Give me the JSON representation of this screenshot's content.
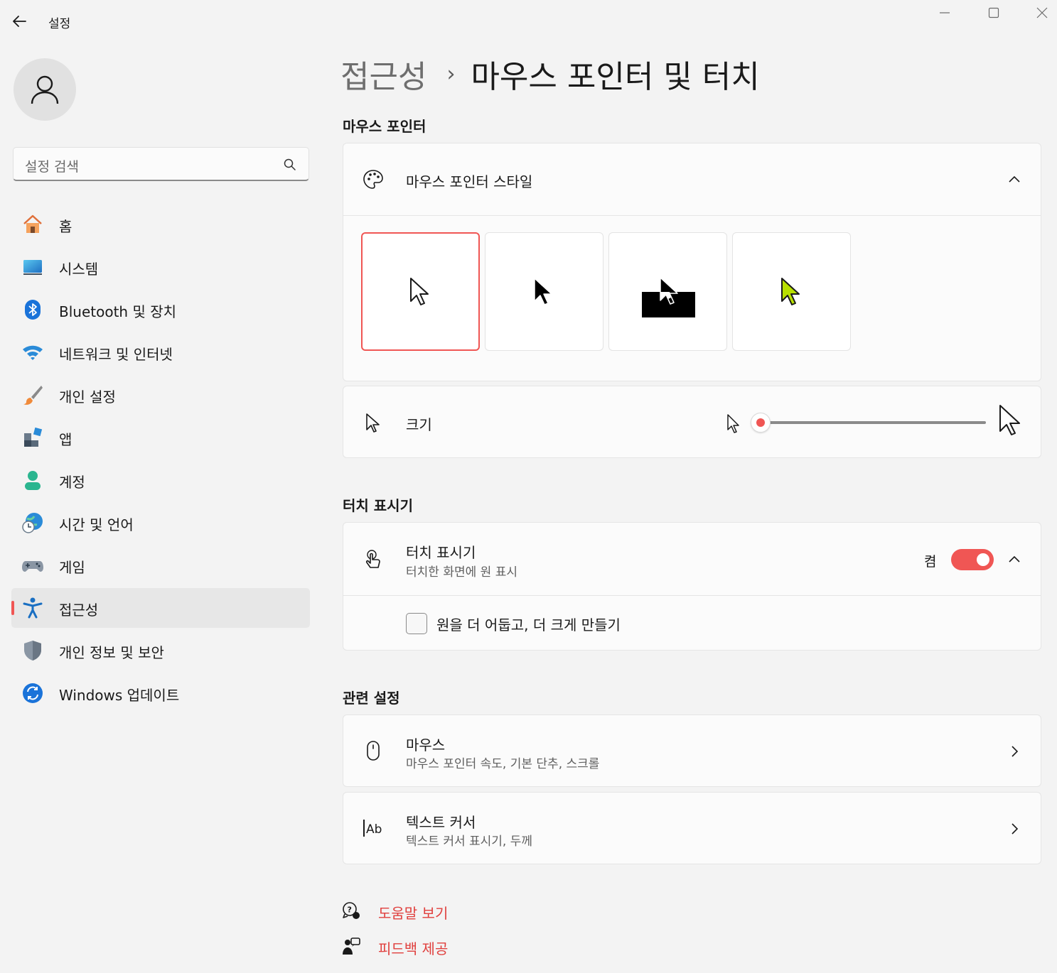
{
  "app": {
    "title": "설정",
    "accent_color": "#f05654"
  },
  "search": {
    "placeholder": "설정 검색"
  },
  "sidebar": {
    "items": [
      {
        "label": "홈",
        "icon": "home-icon"
      },
      {
        "label": "시스템",
        "icon": "system-icon"
      },
      {
        "label": "Bluetooth 및 장치",
        "icon": "bluetooth-icon"
      },
      {
        "label": "네트워크 및 인터넷",
        "icon": "wifi-icon"
      },
      {
        "label": "개인 설정",
        "icon": "paintbrush-icon"
      },
      {
        "label": "앱",
        "icon": "apps-icon"
      },
      {
        "label": "계정",
        "icon": "account-icon"
      },
      {
        "label": "시간 및 언어",
        "icon": "globe-clock-icon"
      },
      {
        "label": "게임",
        "icon": "gamepad-icon"
      },
      {
        "label": "접근성",
        "icon": "accessibility-icon",
        "active": true
      },
      {
        "label": "개인 정보 및 보안",
        "icon": "shield-icon"
      },
      {
        "label": "Windows 업데이트",
        "icon": "update-icon"
      }
    ]
  },
  "breadcrumb": {
    "parent": "접근성",
    "separator": "›",
    "current": "마우스 포인터 및 터치"
  },
  "mouse_pointer": {
    "section_title": "마우스 포인터",
    "style_title": "마우스 포인터 스타일",
    "styles": [
      {
        "name": "white",
        "selected": true
      },
      {
        "name": "black",
        "selected": false
      },
      {
        "name": "inverted",
        "selected": false
      },
      {
        "name": "custom-lime",
        "selected": false
      }
    ],
    "size_label": "크기",
    "size_value": 1
  },
  "touch": {
    "section_title": "터치 표시기",
    "title": "터치 표시기",
    "subtitle": "터치한 화면에 원 표시",
    "toggle_state": "켬",
    "toggle_on": true,
    "checkbox_label": "원을 더 어둡고, 더 크게 만들기",
    "checkbox_checked": false
  },
  "related": {
    "section_title": "관련 설정",
    "items": [
      {
        "title": "마우스",
        "subtitle": "마우스 포인터 속도, 기본 단추, 스크롤",
        "icon": "mouse-icon"
      },
      {
        "title": "텍스트 커서",
        "subtitle": "텍스트 커서 표시기, 두께",
        "icon": "text-cursor-icon"
      }
    ]
  },
  "footer_links": {
    "help": "도움말 보기",
    "feedback": "피드백 제공"
  }
}
